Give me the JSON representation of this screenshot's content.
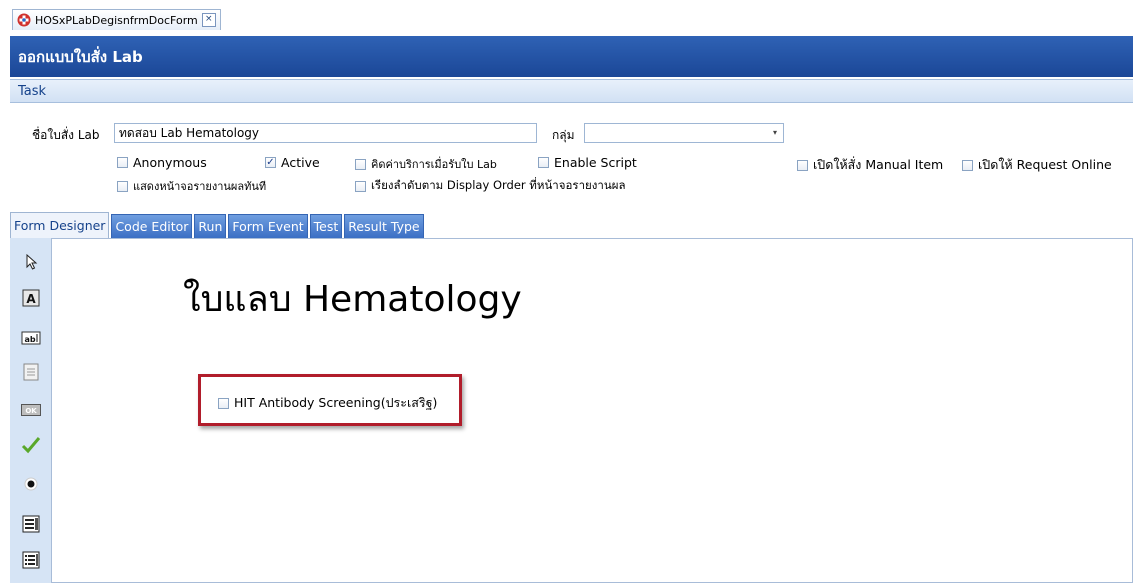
{
  "doc_tab": {
    "title": "HOSxPLabDegisnfrmDocForm",
    "close": "×"
  },
  "title_bar": {
    "title": "ออกแบบใบสั่ง Lab"
  },
  "task_bar": {
    "label": "Task"
  },
  "form": {
    "name_label": "ชื่อใบสั่ง Lab",
    "name_value": "ทดสอบ Lab Hematology",
    "group_label": "กลุ่ม",
    "group_value": "",
    "checkboxes": [
      {
        "label": "Anonymous",
        "checked": false
      },
      {
        "label": "Active",
        "checked": true
      },
      {
        "label": "คิดค่าบริการเมื่อรับใบ Lab",
        "checked": false
      },
      {
        "label": "Enable Script",
        "checked": false
      },
      {
        "label": "เปิดให้สั่ง Manual Item",
        "checked": false
      },
      {
        "label": "เปิดให้ Request Online",
        "checked": false
      },
      {
        "label": "แสดงหน้าจอรายงานผลทันที",
        "checked": false
      },
      {
        "label": "เรียงลำดับตาม Display Order ที่หน้าจอรายงานผล",
        "checked": false
      }
    ]
  },
  "tabs": [
    {
      "label": "Form Designer",
      "active": true
    },
    {
      "label": "Code Editor",
      "active": false
    },
    {
      "label": "Run",
      "active": false
    },
    {
      "label": "Form Event",
      "active": false
    },
    {
      "label": "Test",
      "active": false
    },
    {
      "label": "Result Type",
      "active": false
    }
  ],
  "toolbox": [
    "pointer-icon",
    "label-tool-icon",
    "textbox-tool-icon",
    "memo-tool-icon",
    "button-tool-icon",
    "checkbox-tool-icon",
    "radio-tool-icon",
    "listbox-tool-icon",
    "checklist-tool-icon"
  ],
  "canvas": {
    "title": "ใบแลบ Hematology",
    "item_label": "HIT Antibody Screening(ประเสริฐ)",
    "item_checked": false
  },
  "colors": {
    "title_bar": "#1f4d9e",
    "highlight": "#b11d2b",
    "toolbox": "#d6e4f5"
  }
}
